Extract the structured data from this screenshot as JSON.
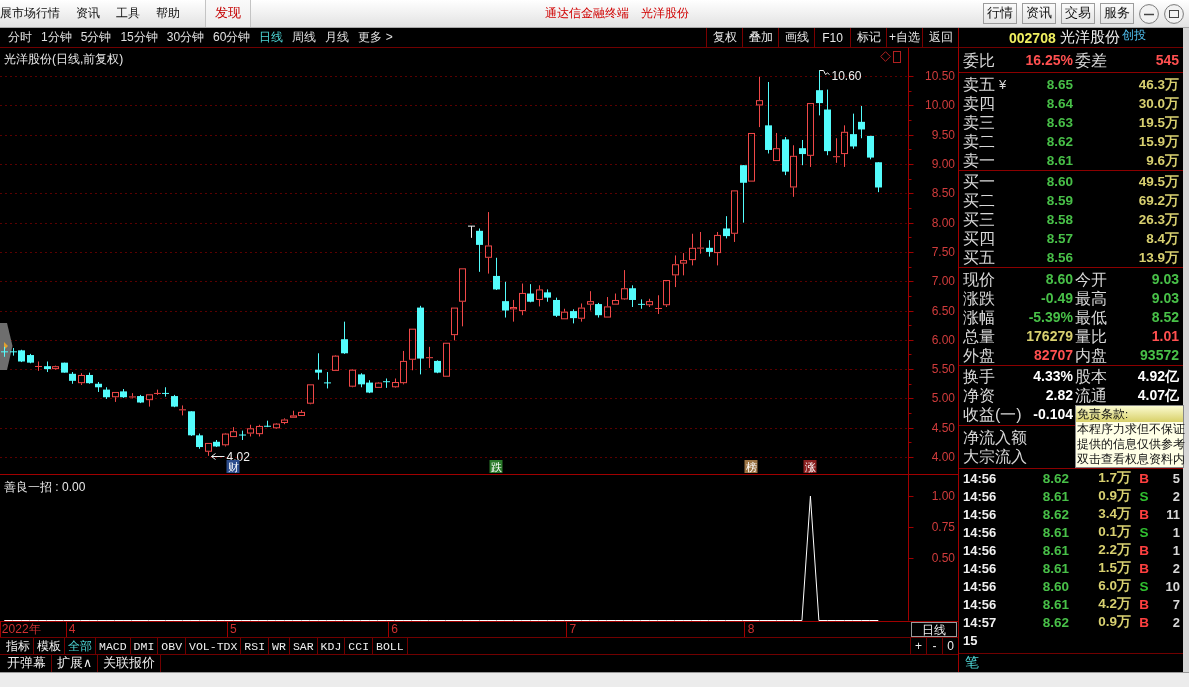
{
  "menu_bar": {
    "items": [
      "展市场行情",
      "资讯",
      "工具",
      "帮助"
    ],
    "discover": "发现",
    "app_title": "通达信金融终端",
    "stock_title": "光洋股份",
    "buttons": [
      "行情",
      "资讯",
      "交易",
      "服务"
    ]
  },
  "period_tabs": [
    {
      "label": "分时",
      "selected": false
    },
    {
      "label": "1分钟",
      "selected": false
    },
    {
      "label": "5分钟",
      "selected": false
    },
    {
      "label": "15分钟",
      "selected": false
    },
    {
      "label": "30分钟",
      "selected": false
    },
    {
      "label": "60分钟",
      "selected": false
    },
    {
      "label": "日线",
      "selected": true
    },
    {
      "label": "周线",
      "selected": false
    },
    {
      "label": "月线",
      "selected": false
    },
    {
      "label": "更多 >",
      "selected": false
    }
  ],
  "toolbar": [
    "复权",
    "叠加",
    "画线",
    "F10",
    "标记",
    "+自选",
    "返回"
  ],
  "price_chart": {
    "title": "光洋股份(日线,前复权)",
    "event_tags": [
      {
        "label": "财",
        "color": "#2c4c8c"
      },
      {
        "label": "跌",
        "color": "#2a7a2a"
      },
      {
        "label": "榜",
        "color": "#9c7444"
      },
      {
        "label": "涨",
        "color": "#8a2020"
      }
    ],
    "chart_data": [
      {
        "type": "candlestick",
        "grid": true,
        "ylim": [
          3.71,
          10.98
        ],
        "annotations": [
          "10.60",
          "4.02"
        ],
        "yticks": [
          {
            "value": 4,
            "label": "4.00"
          },
          {
            "value": 4.5,
            "label": "4.50"
          },
          {
            "value": 5,
            "label": "5.00"
          },
          {
            "value": 5.5,
            "label": "5.50"
          },
          {
            "value": 6,
            "label": "6.00"
          },
          {
            "value": 6.5,
            "label": "6.50"
          },
          {
            "value": 7,
            "label": "7.00"
          },
          {
            "value": 7.5,
            "label": "7.50"
          },
          {
            "value": 8,
            "label": "8.00"
          },
          {
            "value": 8.5,
            "label": "8.50"
          },
          {
            "value": 9,
            "label": "9.00"
          },
          {
            "value": 9.5,
            "label": "9.50"
          },
          {
            "value": 10,
            "label": "10.00"
          },
          {
            "value": 10.5,
            "label": "10.50"
          }
        ],
        "ohlc": [
          [
            5.8,
            5.88,
            5.71,
            5.79
          ],
          [
            5.8,
            5.86,
            5.73,
            5.79
          ],
          [
            5.82,
            5.83,
            5.62,
            5.63
          ],
          [
            5.74,
            5.76,
            5.6,
            5.61
          ],
          [
            5.54,
            5.63,
            5.47,
            5.55
          ],
          [
            5.55,
            5.63,
            5.45,
            5.5
          ],
          [
            5.5,
            5.56,
            5.49,
            5.55
          ],
          [
            5.61,
            5.61,
            5.44,
            5.44
          ],
          [
            5.42,
            5.45,
            5.25,
            5.3
          ],
          [
            5.26,
            5.43,
            5.23,
            5.4
          ],
          [
            5.4,
            5.44,
            5.25,
            5.26
          ],
          [
            5.25,
            5.28,
            5.11,
            5.19
          ],
          [
            5.15,
            5.19,
            4.99,
            5.02
          ],
          [
            5.02,
            5.11,
            4.94,
            5.11
          ],
          [
            5.12,
            5.16,
            5.01,
            5.02
          ],
          [
            5.02,
            5.09,
            5.0,
            5.03
          ],
          [
            5.04,
            5.06,
            4.92,
            4.93
          ],
          [
            4.97,
            5.07,
            4.86,
            5.07
          ],
          [
            5.08,
            5.15,
            5.06,
            5.09
          ],
          [
            5.09,
            5.19,
            5.03,
            5.08
          ],
          [
            5.04,
            5.06,
            4.85,
            4.86
          ],
          [
            4.8,
            4.88,
            4.71,
            4.81
          ],
          [
            4.78,
            4.78,
            4.36,
            4.37
          ],
          [
            4.37,
            4.4,
            4.14,
            4.17
          ],
          [
            4.09,
            4.24,
            4.02,
            4.24
          ],
          [
            4.26,
            4.29,
            4.17,
            4.18
          ],
          [
            4.2,
            4.41,
            4.18,
            4.4
          ],
          [
            4.34,
            4.51,
            4.34,
            4.44
          ],
          [
            4.38,
            4.45,
            4.29,
            4.37
          ],
          [
            4.4,
            4.55,
            4.35,
            4.49
          ],
          [
            4.39,
            4.55,
            4.35,
            4.53
          ],
          [
            4.53,
            4.62,
            4.51,
            4.52
          ],
          [
            4.49,
            4.58,
            4.48,
            4.57
          ],
          [
            4.58,
            4.66,
            4.56,
            4.64
          ],
          [
            4.67,
            4.79,
            4.67,
            4.71
          ],
          [
            4.7,
            4.8,
            4.7,
            4.77
          ],
          [
            4.91,
            5.24,
            4.9,
            5.24
          ],
          [
            5.49,
            5.77,
            5.32,
            5.44
          ],
          [
            5.27,
            5.45,
            5.17,
            5.26
          ],
          [
            5.47,
            5.74,
            5.47,
            5.73
          ],
          [
            6.01,
            6.31,
            5.76,
            5.77
          ],
          [
            5.2,
            5.5,
            5.19,
            5.49
          ],
          [
            5.41,
            5.43,
            5.19,
            5.24
          ],
          [
            5.27,
            5.31,
            5.09,
            5.1
          ],
          [
            5.18,
            5.28,
            5.18,
            5.27
          ],
          [
            5.29,
            5.34,
            5.18,
            5.28
          ],
          [
            5.19,
            5.34,
            5.18,
            5.28
          ],
          [
            5.26,
            5.81,
            5.24,
            5.64
          ],
          [
            5.66,
            6.19,
            5.48,
            6.19
          ],
          [
            6.55,
            6.58,
            5.41,
            5.68
          ],
          [
            5.69,
            5.88,
            5.52,
            5.7
          ],
          [
            5.64,
            5.65,
            5.43,
            5.44
          ],
          [
            5.37,
            5.95,
            5.37,
            5.95
          ],
          [
            6.08,
            6.55,
            5.99,
            6.55
          ],
          [
            6.65,
            7.22,
            6.23,
            7.22
          ],
          [
            7.94,
            7.94,
            7.74,
            7.94
          ],
          [
            7.86,
            7.9,
            7.16,
            7.62
          ],
          [
            7.4,
            8.18,
            7.13,
            7.61
          ],
          [
            7.09,
            7.4,
            6.85,
            6.86
          ],
          [
            6.66,
            6.99,
            6.38,
            6.5
          ],
          [
            6.52,
            6.68,
            6.31,
            6.56
          ],
          [
            6.49,
            6.96,
            6.42,
            6.8
          ],
          [
            6.79,
            6.95,
            6.64,
            6.65
          ],
          [
            6.68,
            6.93,
            6.57,
            6.86
          ],
          [
            6.81,
            6.86,
            6.65,
            6.72
          ],
          [
            6.68,
            6.72,
            6.39,
            6.41
          ],
          [
            6.35,
            6.53,
            6.35,
            6.48
          ],
          [
            6.49,
            6.52,
            6.28,
            6.37
          ],
          [
            6.36,
            6.62,
            6.31,
            6.55
          ],
          [
            6.6,
            6.83,
            6.5,
            6.66
          ],
          [
            6.61,
            6.63,
            6.38,
            6.42
          ],
          [
            6.38,
            6.73,
            6.38,
            6.57
          ],
          [
            6.6,
            6.79,
            6.6,
            6.68
          ],
          [
            6.69,
            7.19,
            6.68,
            6.88
          ],
          [
            6.88,
            6.93,
            6.56,
            6.68
          ],
          [
            6.61,
            6.69,
            6.53,
            6.6
          ],
          [
            6.59,
            6.7,
            6.56,
            6.66
          ],
          [
            6.53,
            6.76,
            6.44,
            6.54
          ],
          [
            6.59,
            7.02,
            6.56,
            7.02
          ],
          [
            7.1,
            7.44,
            6.9,
            7.29
          ],
          [
            7.3,
            7.48,
            7.1,
            7.36
          ],
          [
            7.36,
            7.81,
            7.27,
            7.57
          ],
          [
            7.56,
            7.84,
            7.47,
            7.57
          ],
          [
            7.57,
            7.7,
            7.42,
            7.5
          ],
          [
            7.48,
            7.84,
            7.27,
            7.79
          ],
          [
            7.9,
            8.11,
            7.73,
            7.77
          ],
          [
            7.81,
            8.55,
            7.67,
            8.55
          ],
          [
            8.98,
            8.98,
            8.0,
            8.68
          ],
          [
            8.7,
            9.53,
            8.7,
            9.53
          ],
          [
            10.0,
            10.49,
            9.63,
            10.09
          ],
          [
            9.66,
            10.4,
            9.18,
            9.24
          ],
          [
            9.05,
            9.53,
            9.05,
            9.27
          ],
          [
            9.42,
            9.46,
            8.81,
            8.87
          ],
          [
            8.6,
            9.32,
            8.44,
            9.14
          ],
          [
            9.27,
            9.41,
            8.98,
            9.17
          ],
          [
            9.14,
            10.04,
            8.95,
            10.04
          ],
          [
            10.26,
            10.6,
            9.83,
            10.04
          ],
          [
            9.93,
            10.27,
            9.15,
            9.22
          ],
          [
            9.12,
            9.44,
            9.02,
            9.13
          ],
          [
            9.17,
            9.66,
            8.95,
            9.55
          ],
          [
            9.51,
            9.86,
            9.26,
            9.3
          ],
          [
            9.72,
            9.99,
            9.44,
            9.59
          ],
          [
            9.48,
            9.48,
            9.08,
            9.11
          ],
          [
            9.03,
            9.03,
            8.52,
            8.6
          ],
          null,
          null,
          null
        ]
      }
    ]
  },
  "indicator": {
    "label": "善良一招 : 0.00",
    "period_label": "日线",
    "chart_data": [
      {
        "type": "line",
        "color": "#ffffff",
        "ylim": [
          0,
          1.17
        ],
        "yticks": [
          {
            "value": 0.5,
            "label": "0.50"
          },
          {
            "value": 0.75,
            "label": "0.75"
          },
          {
            "value": 1,
            "label": "1.00"
          }
        ],
        "categories": [
          null,
          null,
          "2022年",
          null,
          null,
          null,
          null,
          null,
          "4",
          null,
          null,
          null,
          null,
          null,
          null,
          null,
          null,
          null,
          null,
          null,
          null,
          null,
          null,
          null,
          null,
          null,
          null,
          "5",
          null,
          null,
          null,
          null,
          null,
          null,
          null,
          null,
          null,
          null,
          null,
          null,
          null,
          null,
          null,
          null,
          null,
          null,
          "6",
          null,
          null,
          null,
          null,
          null,
          null,
          null,
          null,
          null,
          null,
          null,
          null,
          null,
          null,
          null,
          null,
          null,
          null,
          null,
          null,
          "7",
          null,
          null,
          null,
          null,
          null,
          null,
          null,
          null,
          null,
          null,
          null,
          null,
          null,
          null,
          null,
          null,
          null,
          null,
          null,
          null,
          "8",
          null,
          null,
          null,
          null,
          null,
          null,
          null,
          null,
          null,
          null,
          null,
          null,
          null,
          null,
          null
        ],
        "values": [
          0,
          0,
          0,
          0,
          0,
          0,
          0,
          0,
          0,
          0,
          0,
          0,
          0,
          0,
          0,
          0,
          0,
          0,
          0,
          0,
          0,
          0,
          0,
          0,
          0,
          0,
          0,
          0,
          0,
          0,
          0,
          0,
          0,
          0,
          0,
          0,
          0,
          0,
          0,
          0,
          0,
          0,
          0,
          0,
          0,
          0,
          0,
          0,
          0,
          0,
          0,
          0,
          0,
          0,
          0,
          0,
          0,
          0,
          0,
          0,
          0,
          0,
          0,
          0,
          0,
          0,
          0,
          0,
          0,
          0,
          0,
          0,
          0,
          0,
          0,
          0,
          0,
          0,
          0,
          0,
          0,
          0,
          0,
          0,
          0,
          0,
          0,
          0,
          0,
          0,
          0,
          0,
          0,
          0,
          0,
          1,
          0,
          0,
          0,
          0,
          0,
          0,
          0,
          0
        ]
      }
    ]
  },
  "indicator_tabs": [
    {
      "label": "指标",
      "selected": false
    },
    {
      "label": "模板",
      "selected": false
    },
    {
      "label": "全部",
      "selected": true
    },
    {
      "label": "MACD",
      "selected": false
    },
    {
      "label": "DMI",
      "selected": false
    },
    {
      "label": "OBV",
      "selected": false
    },
    {
      "label": "VOL-TDX",
      "selected": false
    },
    {
      "label": "RSI",
      "selected": false
    },
    {
      "label": "WR",
      "selected": false
    },
    {
      "label": "SAR",
      "selected": false
    },
    {
      "label": "KDJ",
      "selected": false
    },
    {
      "label": "CCI",
      "selected": false
    },
    {
      "label": "BOLL",
      "selected": false
    }
  ],
  "zoom_buttons": [
    "+",
    "-",
    "0"
  ],
  "bottom_buttons": [
    "开弹幕",
    "扩展∧",
    "关联报价"
  ],
  "quote": {
    "code": "002708",
    "name": "光洋股份",
    "badge": "创投",
    "ratio": [
      {
        "label": "委比",
        "value": "16.25%",
        "color": "#ff5050"
      },
      {
        "label": "委差",
        "value": "545",
        "color": "#ff5050"
      }
    ],
    "asks": [
      {
        "label": "卖五",
        "marker": "¥",
        "price": "8.65",
        "volume": "46.3万"
      },
      {
        "label": "卖四",
        "price": "8.64",
        "volume": "30.0万"
      },
      {
        "label": "卖三",
        "price": "8.63",
        "volume": "19.5万"
      },
      {
        "label": "卖二",
        "price": "8.62",
        "volume": "15.9万"
      },
      {
        "label": "卖一",
        "price": "8.61",
        "volume": "9.6万"
      }
    ],
    "bids": [
      {
        "label": "买一",
        "price": "8.60",
        "volume": "49.5万"
      },
      {
        "label": "买二",
        "price": "8.59",
        "volume": "69.2万"
      },
      {
        "label": "买三",
        "price": "8.58",
        "volume": "26.3万"
      },
      {
        "label": "买四",
        "price": "8.57",
        "volume": "8.4万"
      },
      {
        "label": "买五",
        "price": "8.56",
        "volume": "13.9万"
      }
    ],
    "stats": [
      [
        {
          "label": "现价",
          "value": "8.60",
          "color": "#48c048"
        },
        {
          "label": "今开",
          "value": "9.03",
          "color": "#48c048"
        }
      ],
      [
        {
          "label": "涨跌",
          "value": "-0.49",
          "color": "#48c048"
        },
        {
          "label": "最高",
          "value": "9.03",
          "color": "#48c048"
        }
      ],
      [
        {
          "label": "涨幅",
          "value": "-5.39%",
          "color": "#48c048"
        },
        {
          "label": "最低",
          "value": "8.52",
          "color": "#48c048"
        }
      ],
      [
        {
          "label": "总量",
          "value": "176279",
          "color": "#d8d070"
        },
        {
          "label": "量比",
          "value": "1.01",
          "color": "#ff5050"
        }
      ],
      [
        {
          "label": "外盘",
          "value": "82707",
          "color": "#ff5050"
        },
        {
          "label": "内盘",
          "value": "93572",
          "color": "#48c048"
        }
      ]
    ],
    "capital": [
      [
        {
          "label": "换手",
          "value": "4.33%",
          "color": "#ffffff"
        },
        {
          "label": "股本",
          "value": "4.92亿",
          "color": "#ffffff"
        }
      ],
      [
        {
          "label": "净资",
          "value": "2.82",
          "color": "#ffffff"
        },
        {
          "label": "流通",
          "value": "4.07亿",
          "color": "#ffffff"
        }
      ],
      [
        {
          "label": "收益(一)",
          "value": "-0.104",
          "color": "#ffffff"
        }
      ]
    ],
    "flows": [
      "净流入额",
      "大宗流入"
    ],
    "disclaimer": {
      "title": "免责条款:",
      "lines": [
        "本程序力求但不保证",
        "提供的信息仅供参考",
        "双击查看权息资料内"
      ]
    },
    "ticks": [
      {
        "time": "14:56",
        "price": "8.62",
        "volume": "1.7万",
        "side": "B",
        "color": "#ff4040",
        "count": "5"
      },
      {
        "time": "14:56",
        "price": "8.61",
        "volume": "0.9万",
        "side": "S",
        "color": "#30c030",
        "count": "2"
      },
      {
        "time": "14:56",
        "price": "8.62",
        "volume": "3.4万",
        "side": "B",
        "color": "#ff4040",
        "count": "11"
      },
      {
        "time": "14:56",
        "price": "8.61",
        "volume": "0.1万",
        "side": "S",
        "color": "#30c030",
        "count": "1"
      },
      {
        "time": "14:56",
        "price": "8.61",
        "volume": "2.2万",
        "side": "B",
        "color": "#ff4040",
        "count": "1"
      },
      {
        "time": "14:56",
        "price": "8.61",
        "volume": "1.5万",
        "side": "B",
        "color": "#ff4040",
        "count": "2"
      },
      {
        "time": "14:56",
        "price": "8.60",
        "volume": "6.0万",
        "side": "S",
        "color": "#30c030",
        "count": "10"
      },
      {
        "time": "14:56",
        "price": "8.61",
        "volume": "4.2万",
        "side": "B",
        "color": "#ff4040",
        "count": "7"
      },
      {
        "time": "14:57",
        "price": "8.62",
        "volume": "0.9万",
        "side": "B",
        "color": "#ff4040",
        "count": "2"
      },
      {
        "time": "15"
      }
    ],
    "tabs": [
      "笔"
    ]
  }
}
